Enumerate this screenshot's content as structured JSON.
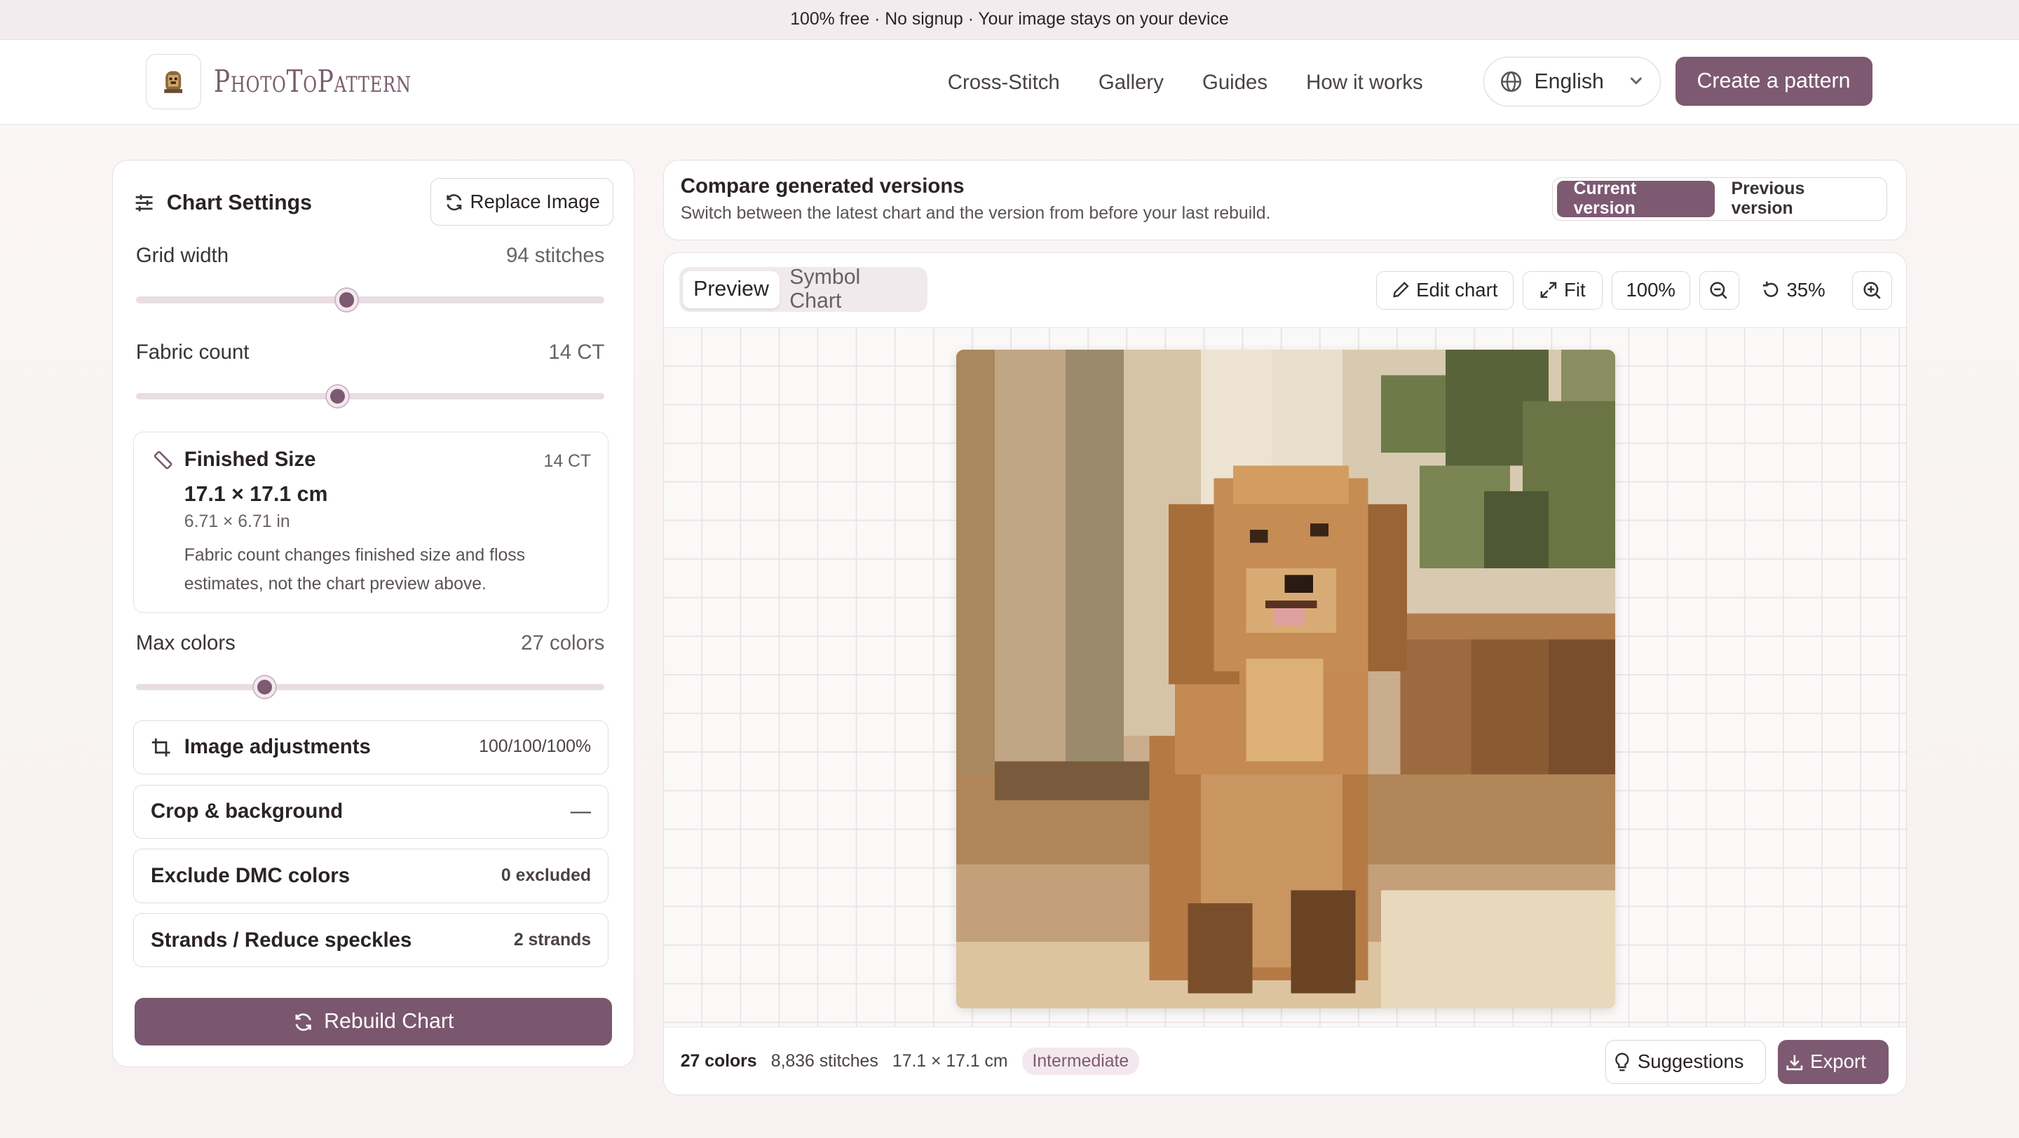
{
  "banner": {
    "text": "100% free · No signup · Your image stays on your device"
  },
  "brand": {
    "name": "PhotoToPattern",
    "accent": "#7d5a71"
  },
  "nav": {
    "items": [
      "Cross-Stitch",
      "Gallery",
      "Guides",
      "How it works"
    ]
  },
  "language": {
    "selected": "English"
  },
  "header": {
    "cta": "Create a pattern"
  },
  "settings": {
    "title": "Chart Settings",
    "replace_label": "Replace Image",
    "grid_width": {
      "label": "Grid width",
      "value_text": "94 stitches",
      "slider_fraction": 0.45
    },
    "fabric_count": {
      "label": "Fabric count",
      "value_text": "14 CT",
      "slider_fraction": 0.43
    },
    "finished_size": {
      "title": "Finished Size",
      "ct": "14 CT",
      "cm": "17.1 × 17.1 cm",
      "inches": "6.71 × 6.71 in",
      "note": "Fabric count changes finished size and floss estimates, not the chart preview above."
    },
    "max_colors": {
      "label": "Max colors",
      "value_text": "27 colors",
      "slider_fraction": 0.275
    },
    "image_adjustments": {
      "label": "Image adjustments",
      "value": "100/100/100%"
    },
    "crop": {
      "label": "Crop & background",
      "value": "—"
    },
    "exclude": {
      "label": "Exclude DMC colors",
      "value": "0 excluded"
    },
    "strands": {
      "label": "Strands / Reduce speckles",
      "value": "2 strands"
    },
    "rebuild_label": "Rebuild Chart"
  },
  "compare": {
    "title": "Compare generated versions",
    "subtitle": "Switch between the latest chart and the version from before your last rebuild.",
    "current": "Current version",
    "previous": "Previous version"
  },
  "viewer": {
    "tab_preview": "Preview",
    "tab_symbol": "Symbol Chart",
    "edit_label": "Edit chart",
    "fit_label": "Fit",
    "zoom_reset": "100%",
    "zoom_level": "35%"
  },
  "footer": {
    "colors": "27 colors",
    "stitches": "8,836 stitches",
    "size": "17.1 × 17.1 cm",
    "difficulty": "Intermediate",
    "suggestions": "Suggestions",
    "export": "Export"
  }
}
